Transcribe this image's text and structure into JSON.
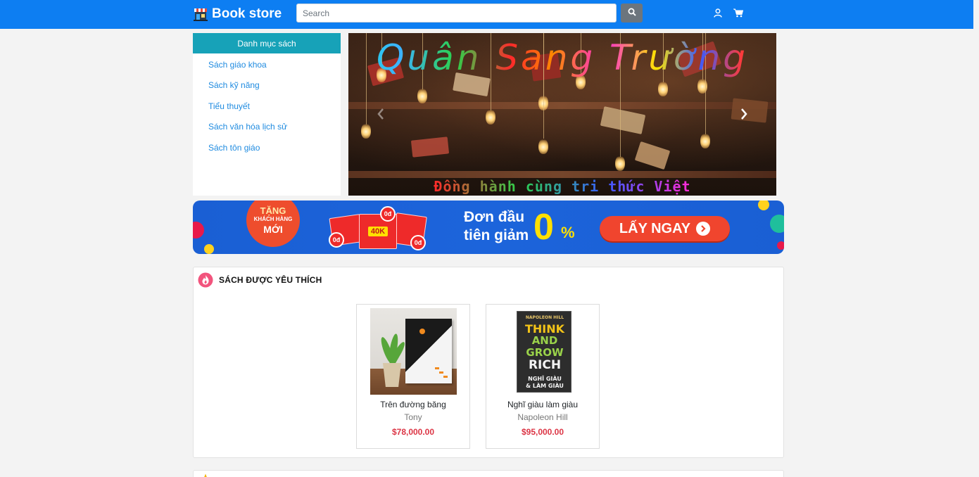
{
  "navbar": {
    "brand": "Book store",
    "search_placeholder": "Search"
  },
  "sidebar": {
    "title": "Danh mục sách",
    "items": [
      {
        "label": "Sách giáo khoa"
      },
      {
        "label": "Sách kỹ năng"
      },
      {
        "label": "Tiểu thuyết"
      },
      {
        "label": "Sách văn hóa lịch sử"
      },
      {
        "label": "Sách tôn giáo"
      }
    ]
  },
  "carousel": {
    "title": "Quân Sang Trường",
    "subtitle": "Đồng hành cùng tri thức Việt"
  },
  "promo": {
    "badge_line1": "TẶNG",
    "badge_line2": "KHÁCH HÀNG",
    "badge_line3": "MỚI",
    "voucher_amount": "40K",
    "voucher_zero": "0đ",
    "headline_line1": "Đơn đầu",
    "headline_line2": "tiên giảm",
    "headline_value": "0",
    "headline_unit": "%",
    "cta": "LẤY NGAY"
  },
  "favorites": {
    "title": "SÁCH ĐƯỢC YÊU THÍCH",
    "products": [
      {
        "name": "Trên đường băng",
        "author": "Tony",
        "price": "$78,000.00"
      },
      {
        "name": "Nghĩ giàu làm giàu",
        "author": "Napoleon Hill",
        "price": "$95,000.00"
      }
    ]
  },
  "covers": {
    "book2_author": "NAPOLEON HILL",
    "book2_line1": "THINK",
    "book2_line2": "AND",
    "book2_line3": "GROW",
    "book2_line4": "RICH",
    "book2_vn1": "NGHĨ GIÀU",
    "book2_vn2": "& LÀM GIÀU"
  },
  "colors": {
    "navbar": "#0d7ef2",
    "sidebar_header": "#17a2b8",
    "link": "#1f8be0",
    "price": "#dc3545",
    "promo_bg": "#1a5fd4",
    "cta": "#f0452e"
  },
  "icons": {
    "brand": "store-icon",
    "search": "search-icon",
    "user": "user-icon",
    "cart": "cart-icon",
    "prev": "chevron-left-icon",
    "next": "chevron-right-icon",
    "favorites": "fire-icon"
  }
}
